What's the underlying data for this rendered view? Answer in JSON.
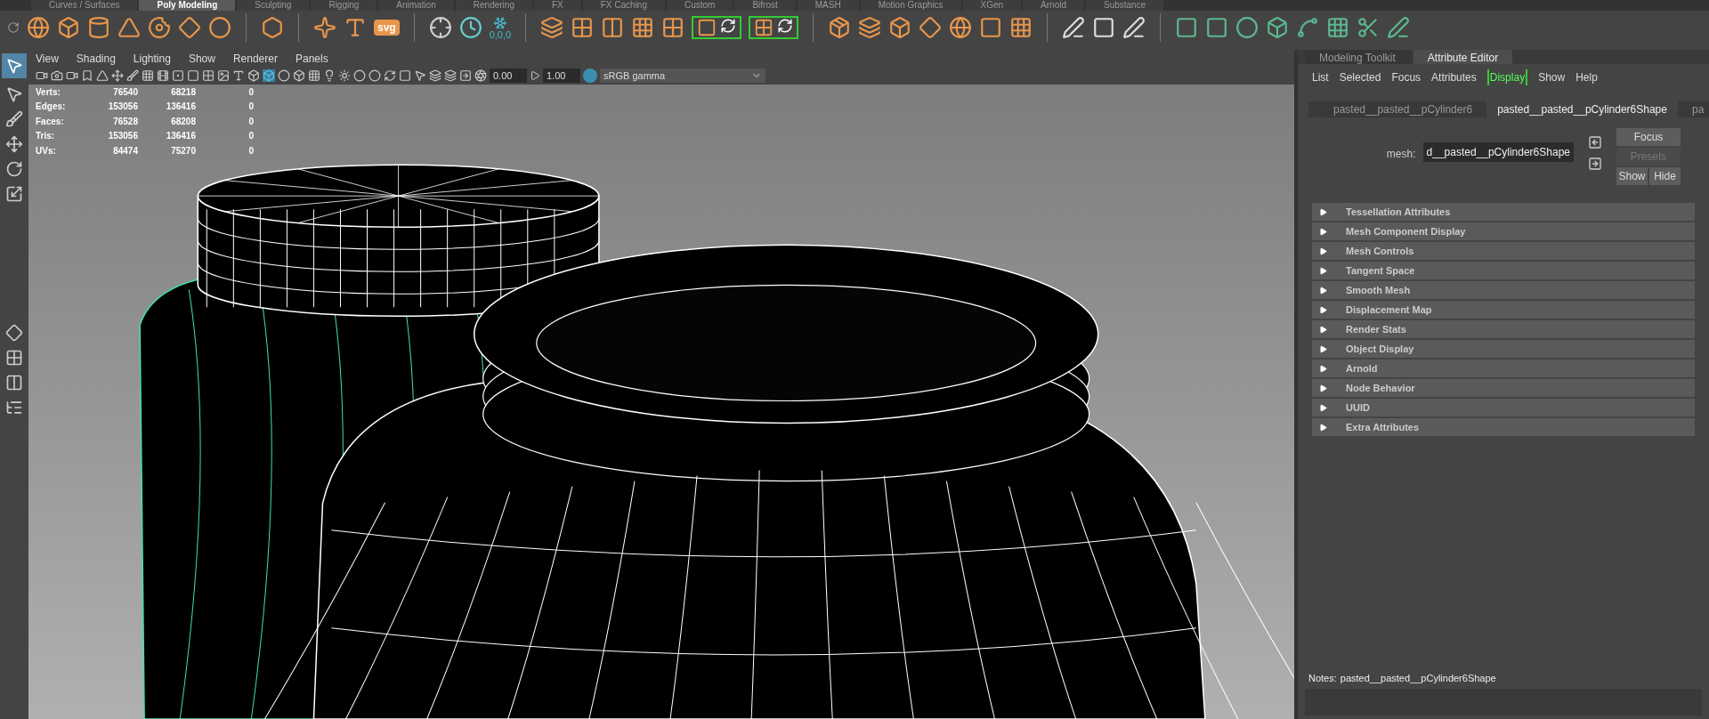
{
  "shelf_tabs": [
    {
      "label": "Curves / Surfaces",
      "selected": false
    },
    {
      "label": "Poly Modeling",
      "selected": true
    },
    {
      "label": "Sculpting",
      "selected": false
    },
    {
      "label": "Rigging",
      "selected": false
    },
    {
      "label": "Animation",
      "selected": false
    },
    {
      "label": "Rendering",
      "selected": false
    },
    {
      "label": "FX",
      "selected": false
    },
    {
      "label": "FX Caching",
      "selected": false
    },
    {
      "label": "Custom",
      "selected": false
    },
    {
      "label": "Bifrost",
      "selected": false
    },
    {
      "label": "MASH",
      "selected": false
    },
    {
      "label": "Motion Graphics",
      "selected": false
    },
    {
      "label": "XGen",
      "selected": false
    },
    {
      "label": "Arnold",
      "selected": false
    },
    {
      "label": "Substance",
      "selected": false
    }
  ],
  "shelf": {
    "svg_label": "svg",
    "reset_label": "0,0,0"
  },
  "viewport": {
    "menu": [
      "View",
      "Shading",
      "Lighting",
      "Show",
      "Renderer",
      "Panels"
    ],
    "exposure": "0.00",
    "gamma": "1.00",
    "color_space": "sRGB gamma",
    "hud": [
      {
        "label": "Verts:",
        "values": [
          "76540",
          "68218",
          "0"
        ]
      },
      {
        "label": "Edges:",
        "values": [
          "153056",
          "136416",
          "0"
        ]
      },
      {
        "label": "Faces:",
        "values": [
          "76528",
          "68208",
          "0"
        ]
      },
      {
        "label": "Tris:",
        "values": [
          "153056",
          "136416",
          "0"
        ]
      },
      {
        "label": "UVs:",
        "values": [
          "84474",
          "75270",
          "0"
        ]
      }
    ]
  },
  "attribute_panel": {
    "tabs": [
      {
        "label": "Modeling Toolkit",
        "selected": false
      },
      {
        "label": "Attribute Editor",
        "selected": true
      }
    ],
    "menu": [
      {
        "label": "List",
        "highlighted": false
      },
      {
        "label": "Selected",
        "highlighted": false
      },
      {
        "label": "Focus",
        "highlighted": false
      },
      {
        "label": "Attributes",
        "highlighted": false
      },
      {
        "label": "Display",
        "highlighted": true
      },
      {
        "label": "Show",
        "highlighted": false
      },
      {
        "label": "Help",
        "highlighted": false
      }
    ],
    "node_tabs": [
      {
        "label": "pasted__pasted__pCylinder6",
        "selected": false
      },
      {
        "label": "pasted__pasted__pCylinder6Shape",
        "selected": true
      },
      {
        "label": "pa",
        "selected": false
      }
    ],
    "mesh_label": "mesh:",
    "mesh_value": "d__pasted__pCylinder6Shape",
    "focus_button": {
      "label": "Focus",
      "disabled": false
    },
    "presets_button": {
      "label": "Presets",
      "disabled": true
    },
    "show_button": {
      "label": "Show",
      "disabled": false
    },
    "hide_button": {
      "label": "Hide",
      "disabled": false
    },
    "sections": [
      {
        "label": "Tessellation Attributes",
        "expanded": false
      },
      {
        "label": "Mesh Component Display",
        "expanded": false
      },
      {
        "label": "Mesh Controls",
        "expanded": false
      },
      {
        "label": "Tangent Space",
        "expanded": false
      },
      {
        "label": "Smooth Mesh",
        "expanded": false
      },
      {
        "label": "Displacement Map",
        "expanded": false
      },
      {
        "label": "Render Stats",
        "expanded": false
      },
      {
        "label": "Object Display",
        "expanded": false
      },
      {
        "label": "Arnold",
        "expanded": false
      },
      {
        "label": "Node Behavior",
        "expanded": false
      },
      {
        "label": "UUID",
        "expanded": false
      },
      {
        "label": "Extra Attributes",
        "expanded": false
      }
    ],
    "notes_label": "Notes:",
    "notes_value": "pasted__pasted__pCylinder6Shape"
  }
}
